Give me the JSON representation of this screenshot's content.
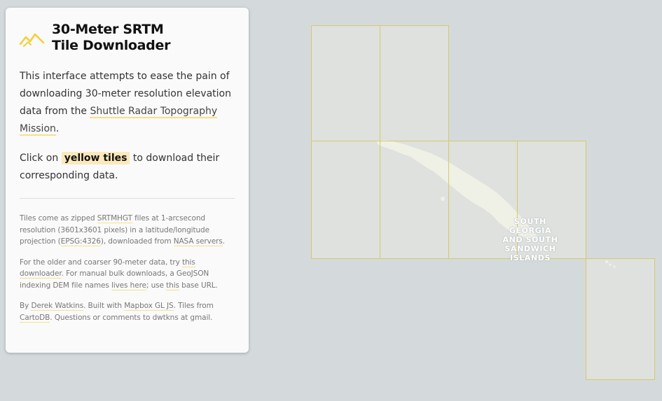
{
  "panel": {
    "title_line1": "30-Meter SRTM",
    "title_line2": "Tile Downloader",
    "intro_1": "This interface attempts to ease the pain of downloading 30-meter resolution elevation data from the ",
    "intro_link": "Shuttle Radar Topography Mission",
    "intro_2": ".",
    "click_1": "Click on ",
    "click_highlight": "yellow tiles",
    "click_2": " to download their corresponding data.",
    "info_1": "Tiles come as zipped ",
    "info_link_srtmhgt": "SRTMHGT",
    "info_2": " files at 1-arcsecond resolution (3601x3601 pixels) in a latitude/longitude projection (",
    "info_link_epsg": "EPSG:4326",
    "info_3": "), downloaded from ",
    "info_link_nasa": "NASA servers",
    "info_4": ".",
    "older_1": "For the older and coarser 90-meter data, try ",
    "older_link_downloader": "this downloader",
    "older_2": ". For manual bulk downloads, a GeoJSON indexing DEM file names ",
    "older_link_lives": "lives here",
    "older_3": "; use ",
    "older_link_this": "this",
    "older_4": " base URL.",
    "credit_1": "By ",
    "credit_link_author": "Derek Watkins",
    "credit_2": ". Built with ",
    "credit_link_mapbox": "Mapbox GL JS",
    "credit_3": ". Tiles from ",
    "credit_link_carto": "CartoDB",
    "credit_4": ". Questions or comments to dwtkns at gmail."
  },
  "map": {
    "label_line1": "SOUTH",
    "label_line2": "GEORGIA",
    "label_line3": "AND SOUTH",
    "label_line4": "SANDWICH",
    "label_line5": "ISLANDS",
    "background_color": "#d4dadc",
    "land_color": "#fbfaf0",
    "tile_border_color": "#d6c96a"
  }
}
